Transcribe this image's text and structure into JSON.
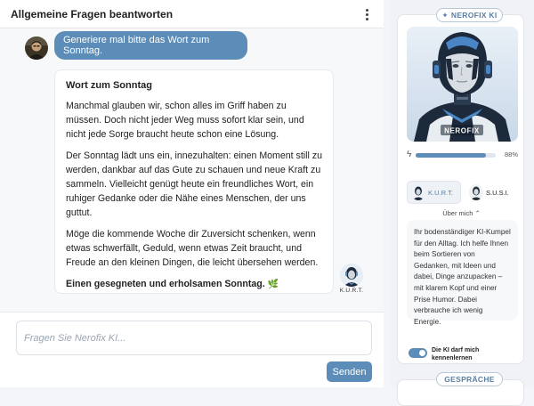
{
  "chat": {
    "title": "Allgemeine Fragen beantworten",
    "user_message": "Generiere mal bitte das Wort zum Sonntag.",
    "ai_reply": {
      "heading": "Wort zum Sonntag",
      "paragraphs": [
        "Manchmal glauben wir, schon alles im Griff haben zu müssen. Doch nicht jeder Weg muss sofort klar sein, und nicht jede Sorge braucht heute schon eine Lösung.",
        "Der Sonntag lädt uns ein, innezuhalten: einen Moment still zu werden, dankbar auf das Gute zu schauen und neue Kraft zu sammeln. Vielleicht genügt heute ein freundliches Wort, ein ruhiger Gedanke oder die Nähe eines Menschen, der uns guttut.",
        "Möge die kommende Woche dir Zuversicht schenken, wenn etwas schwerfällt, Geduld, wenn etwas Zeit braucht, und Freude an den kleinen Dingen, die leicht übersehen werden."
      ],
      "closing": "Einen gesegneten und erholsamen Sonntag.",
      "closing_emoji": "🌿",
      "agent_label": "K.U.R.T."
    },
    "input_placeholder": "Fragen Sie Nerofix KI...",
    "send_label": "Senden"
  },
  "sidebar": {
    "badge_icon": "✦",
    "badge_label": "NEROFIX KI",
    "robot_brand": "NEROFIX",
    "energy_icon": "lightning-bolt",
    "energy_percent_value": 88,
    "energy_percent_label": "88%",
    "agents": [
      {
        "name": "K.U.R.T.",
        "active": true
      },
      {
        "name": "S.U.S.I.",
        "active": false
      }
    ],
    "about_label": "Über mich",
    "description": "Ihr bodenständiger KI-Kumpel für den Alltag. Ich helfe Ihnen beim Sortieren von Gedanken, mit Ideen und dabei, Dinge anzupacken – mit klarem Kopf und einer Prise Humor. Dabei verbrauche ich wenig Energie.",
    "toggle_label": "Die KI darf mich kennenlernen",
    "toggle_on": true,
    "second_section_label": "GESPRÄCHE"
  },
  "colors": {
    "accent": "#5b8db8",
    "robot_bg": "#dce7f1",
    "robot_dark": "#1c2a3c"
  }
}
